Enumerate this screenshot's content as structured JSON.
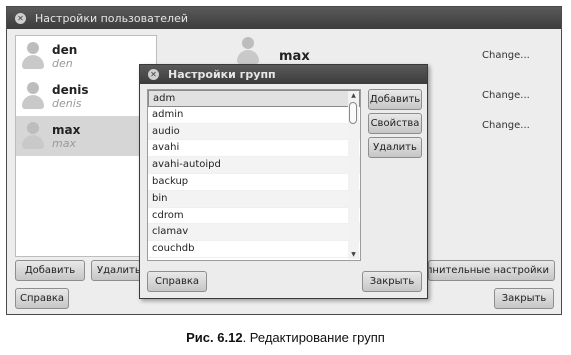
{
  "users_window": {
    "title": "Настройки пользователей",
    "users": [
      {
        "name": "den",
        "login": "den"
      },
      {
        "name": "denis",
        "login": "denis"
      },
      {
        "name": "max",
        "login": "max"
      }
    ],
    "selected_user": "max",
    "change_links": [
      "Change...",
      "Change...",
      "Change..."
    ],
    "add_button": "Добавить",
    "delete_button": "Удалить",
    "advanced_button": "олнительные настройки",
    "help_button": "Справка",
    "close_button": "Закрыть"
  },
  "groups_dialog": {
    "title": "Настройки групп",
    "groups": [
      "adm",
      "admin",
      "audio",
      "avahi",
      "avahi-autoipd",
      "backup",
      "bin",
      "cdrom",
      "clamav",
      "couchdb"
    ],
    "selected_group": "adm",
    "add_button": "Добавить",
    "properties_button": "Свойства",
    "delete_button": "Удалить",
    "help_button": "Справка",
    "close_button": "Закрыть"
  },
  "caption": {
    "number": "Рис. 6.12",
    "text": ". Редактирование групп"
  }
}
